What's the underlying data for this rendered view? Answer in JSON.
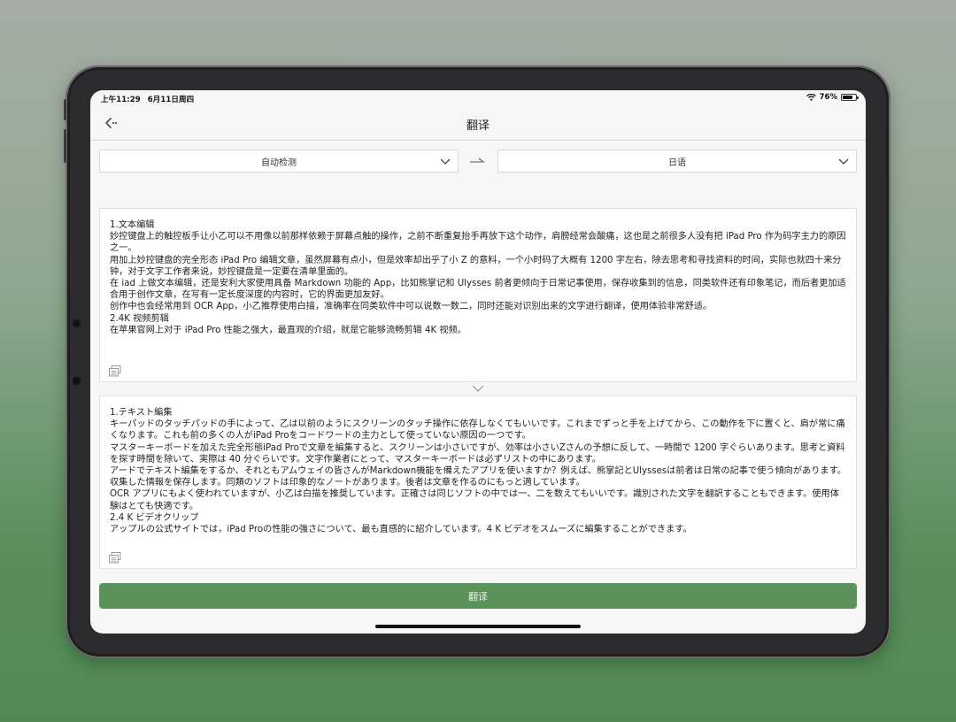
{
  "status_bar": {
    "time": "上午11:29",
    "date": "6月11日周四",
    "battery_text": "76%",
    "battery_level": 0.76
  },
  "nav": {
    "title": "翻译",
    "back_icon": "back-arrow-icon"
  },
  "languages": {
    "source": "自动检测",
    "target": "日语",
    "swap_icon": "arrow-right-icon"
  },
  "source_text": "1.文本编辑\n妙控键盘上的触控板手让小乙可以不用像以前那样依赖于屏幕点触的操作，之前不断重复抬手再放下这个动作，肩膀经常会酸痛，这也是之前很多人没有把 iPad Pro 作为码字主力的原因之一。\n用加上妙控键盘的完全形态 iPad Pro 编辑文章，虽然屏幕有点小，但是效率却出乎了小 Z 的意料，一个小时码了大概有 1200 字左右，除去思考和寻找资料的时间，实际也就四十来分钟，对于文字工作者来说，妙控键盘是一定要在清单里面的。\n在 iad 上做文本编辑，还是安利大家使用具备 Markdown 功能的 App，比如熊掌记和 Ulysses 前者更倾向于日常记事使用，保存收集到的信息，同类软件还有印象笔记，而后者更加适合用于创作文章，在写有一定长度深度的内容时，它的界面更加友好。\n创作中也会经常用到 OCR App，小乙推荐使用白描，准确率在同类软件中可以说数一数二，同时还能对识别出来的文字进行翻译，使用体验非常舒适。\n2.4K 视频剪辑\n在苹果官网上对于 iPad Pro 性能之强大，最直观的介绍，就是它能够流畅剪辑 4K 视频。",
  "target_text": "1.テキスト編集\nキーパッドのタッチパッドの手によって、乙は以前のようにスクリーンのタッチ操作に依存しなくてもいいです。これまでずっと手を上げてから、この動作を下に置くと、肩が常に痛くなります。これも前の多くの人がiPad Proをコードワードの主力として使っていない原因の一つです。\nマスターキーボードを加えた完全形態iPad Proで文章を編集すると、スクリーンは小さいですが、効率は小さいZさんの予想に反して、一時間で 1200 字ぐらいあります。思考と資料を探す時間を除いて、実際は 40 分ぐらいです。文字作業者にとって、マスターキーボードは必ずリストの中にあります。\nアードでテキスト編集をするか、それともアムウェイの皆さんがMarkdown機能を備えたアプリを使いますか？例えば、熊掌記とUlyssesは前者は日常の記事で使う傾向があります。収集した情報を保存します。同類のソフトは印象的なノートがあります。後者は文章を作るのにもっと適しています。\nOCR アプリにもよく使われていますが、小乙は白描を推奨しています。正確さは同じソフトの中では一、二を数えてもいいです。識別された文字を翻訳することもできます。使用体験はとても快適です。\n2.4 K ビデオクリップ\nアップルの公式サイトでは，iPad Proの性能の強さについて、最も直感的に紹介しています。4 K ビデオをスムーズに編集することができます。",
  "buttons": {
    "translate": "翻译"
  },
  "icons": {
    "copy": "copy-icon",
    "collapse": "chevron-down-icon",
    "wifi": "wifi-icon",
    "battery": "battery-icon"
  }
}
